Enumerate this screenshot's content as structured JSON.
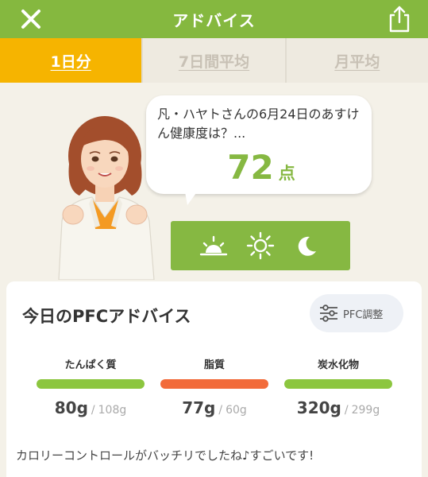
{
  "header": {
    "title": "アドバイス",
    "close_icon": "close-icon",
    "share_icon": "share-icon",
    "color": "#85b83f"
  },
  "tabs": [
    {
      "label": "1日分",
      "active": true
    },
    {
      "label": "7日間平均",
      "active": false
    },
    {
      "label": "月平均",
      "active": false
    }
  ],
  "bubble": {
    "message": "凡・ハヤトさんの6月24日のあすけん健康度は？...",
    "score": "72",
    "score_unit": "点"
  },
  "time_selector": [
    {
      "icon": "sunrise-icon"
    },
    {
      "icon": "sun-icon"
    },
    {
      "icon": "moon-icon"
    }
  ],
  "pfc": {
    "title": "今日のPFCアドバイス",
    "adjust_label": "PFC調整",
    "adjust_icon": "sliders-icon",
    "nutrients": [
      {
        "name": "たんぱく質",
        "value": "80g",
        "target": "108g",
        "bar_color": "#8cc63f"
      },
      {
        "name": "脂質",
        "value": "77g",
        "target": "60g",
        "bar_color": "#f26b3a"
      },
      {
        "name": "炭水化物",
        "value": "320g",
        "target": "299g",
        "bar_color": "#8cc63f"
      }
    ],
    "separator": "/",
    "advice": "カロリーコントロールがバッチリでしたね♪すごいです!"
  }
}
